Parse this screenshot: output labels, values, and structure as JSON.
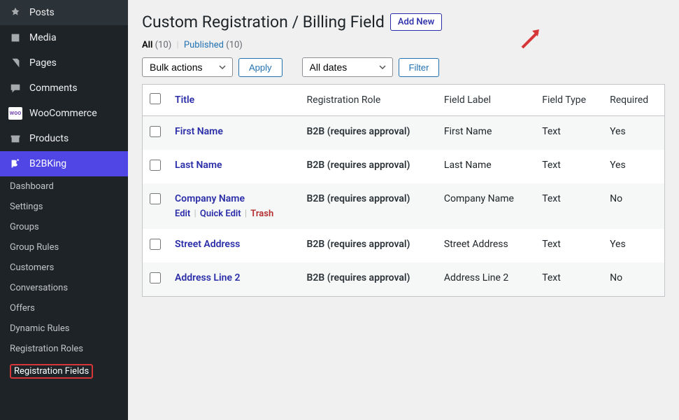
{
  "sidebar": {
    "posts": "Posts",
    "media": "Media",
    "pages": "Pages",
    "comments": "Comments",
    "woocommerce": "WooCommerce",
    "products": "Products",
    "b2bking": "B2BKing",
    "sub": {
      "dashboard": "Dashboard",
      "settings": "Settings",
      "groups": "Groups",
      "group_rules": "Group Rules",
      "customers": "Customers",
      "conversations": "Conversations",
      "offers": "Offers",
      "dynamic_rules": "Dynamic Rules",
      "registration_roles": "Registration Roles",
      "registration_fields": "Registration Fields"
    }
  },
  "header": {
    "title": "Custom Registration / Billing Field",
    "add_new": "Add New"
  },
  "subsub": {
    "all_label": "All",
    "all_count": "(10)",
    "published_label": "Published",
    "published_count": "(10)"
  },
  "controls": {
    "bulk_actions": "Bulk actions",
    "apply": "Apply",
    "all_dates": "All dates",
    "filter": "Filter"
  },
  "columns": {
    "title": "Title",
    "role": "Registration Role",
    "label": "Field Label",
    "type": "Field Type",
    "required": "Required"
  },
  "row_actions": {
    "edit": "Edit",
    "quick_edit": "Quick Edit",
    "trash": "Trash"
  },
  "rows": [
    {
      "title": "First Name",
      "role": "B2B (requires approval)",
      "label": "First Name",
      "type": "Text",
      "required": "Yes",
      "hover": false
    },
    {
      "title": "Last Name",
      "role": "B2B (requires approval)",
      "label": "Last Name",
      "type": "Text",
      "required": "Yes",
      "hover": false
    },
    {
      "title": "Company Name",
      "role": "B2B (requires approval)",
      "label": "Company Name",
      "type": "Text",
      "required": "No",
      "hover": true
    },
    {
      "title": "Street Address",
      "role": "B2B (requires approval)",
      "label": "Street Address",
      "type": "Text",
      "required": "Yes",
      "hover": false
    },
    {
      "title": "Address Line 2",
      "role": "B2B (requires approval)",
      "label": "Address Line 2",
      "type": "Text",
      "required": "No",
      "hover": false
    }
  ]
}
